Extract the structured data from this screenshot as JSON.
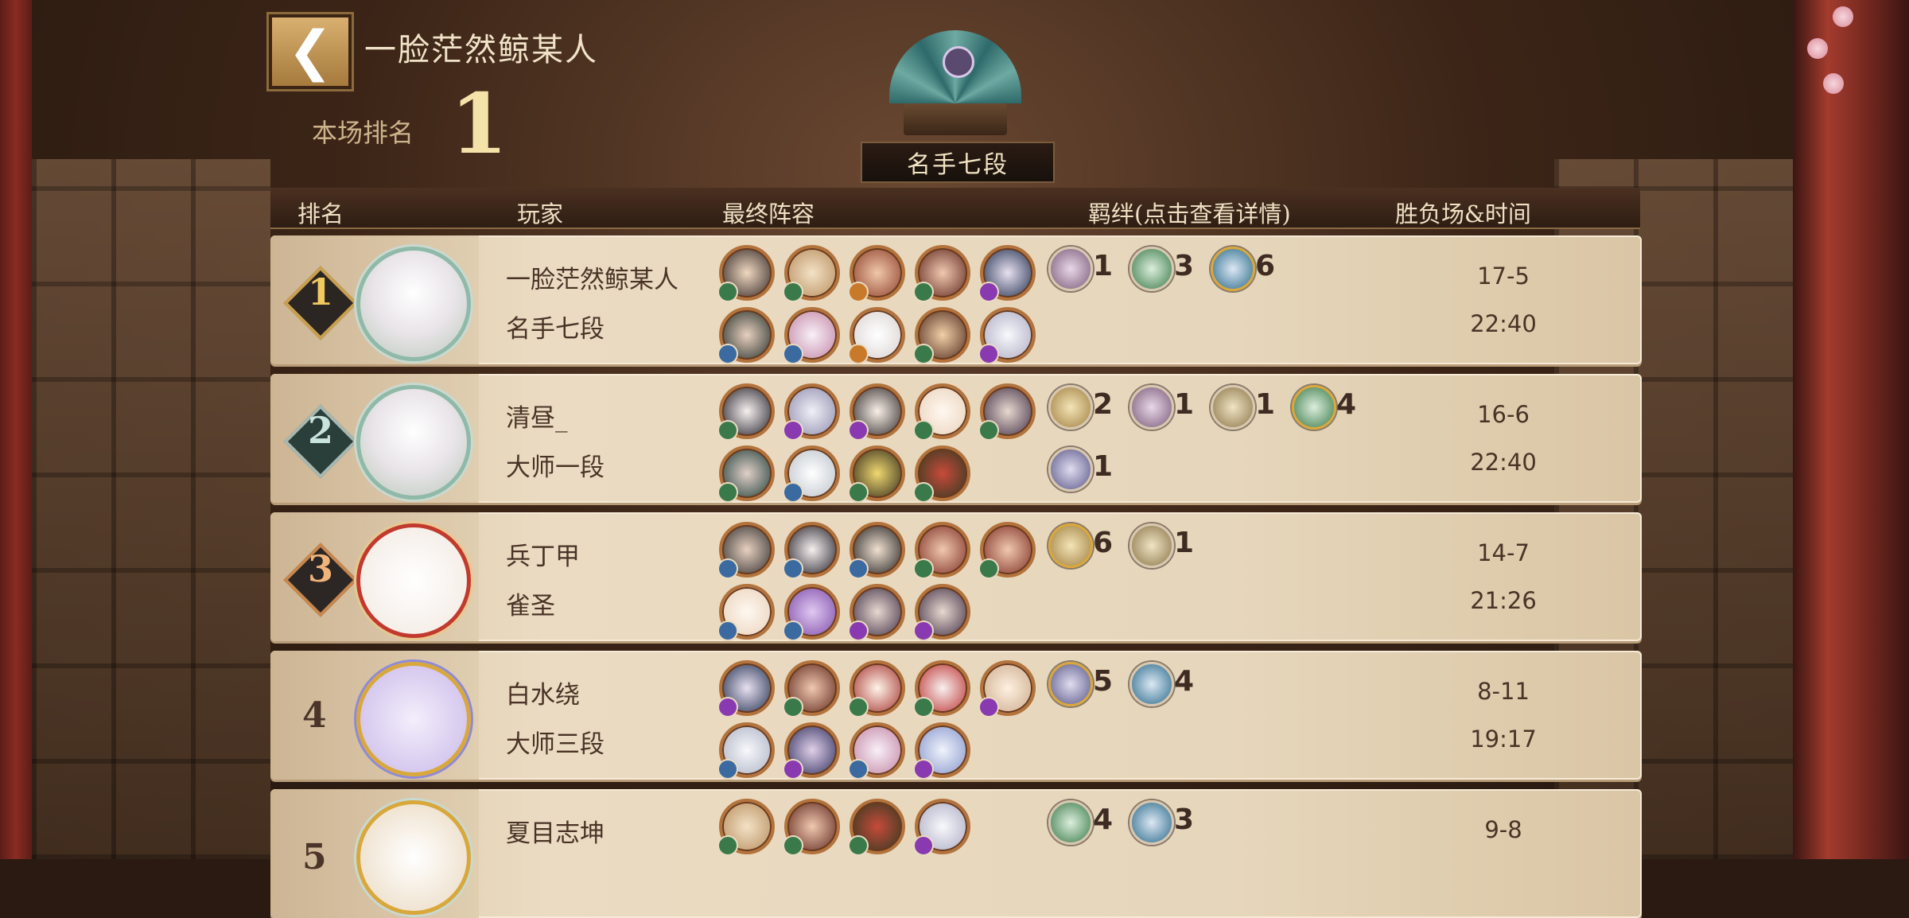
{
  "header": {
    "player_name": "一脸茫然鲸某人",
    "rank_label": "本场排名",
    "rank_value": "1",
    "title_badge": "名手七段"
  },
  "columns": {
    "rank": "排名",
    "player": "玩家",
    "lineup": "最终阵容",
    "bonds": "羁绊(点击查看详情)",
    "result": "胜负场&时间"
  },
  "rows": [
    {
      "rank": "1",
      "name": "一脸茫然鲸某人",
      "tier": "名手七段",
      "score": "17-5",
      "time": "22:40",
      "bonds": [
        {
          "icon": "purple-swirl-bond-icon",
          "count": "1"
        },
        {
          "icon": "green-leaf-bond-icon",
          "count": "3"
        },
        {
          "icon": "blue-clover-bond-icon",
          "count": "6"
        }
      ]
    },
    {
      "rank": "2",
      "name": "清昼_",
      "tier": "大师一段",
      "score": "16-6",
      "time": "22:40",
      "bonds": [
        {
          "icon": "gold-coin-bond-icon",
          "count": "2"
        },
        {
          "icon": "purple-swirl-bond-icon",
          "count": "1"
        },
        {
          "icon": "gold-mask-bond-icon",
          "count": "1"
        },
        {
          "icon": "green-leaf-bond-icon",
          "count": "4"
        },
        {
          "icon": "purple-spiral-bond-icon",
          "count": "1"
        }
      ]
    },
    {
      "rank": "3",
      "name": "兵丁甲",
      "tier": "雀圣",
      "score": "14-7",
      "time": "21:26",
      "bonds": [
        {
          "icon": "gold-coin-bond-icon",
          "count": "6"
        },
        {
          "icon": "gold-mask-bond-icon",
          "count": "1"
        }
      ]
    },
    {
      "rank": "4",
      "name": "白水绕",
      "tier": "大师三段",
      "score": "8-11",
      "time": "19:17",
      "bonds": [
        {
          "icon": "purple-spiral-bond-icon",
          "count": "5"
        },
        {
          "icon": "blue-clover-bond-icon",
          "count": "4"
        }
      ]
    },
    {
      "rank": "5",
      "name": "夏目志坤",
      "tier": "",
      "score": "9-8",
      "time": "",
      "bonds": [
        {
          "icon": "green-leaf-bond-icon",
          "count": "4"
        },
        {
          "icon": "blue-clover-bond-icon",
          "count": "3"
        }
      ]
    }
  ]
}
